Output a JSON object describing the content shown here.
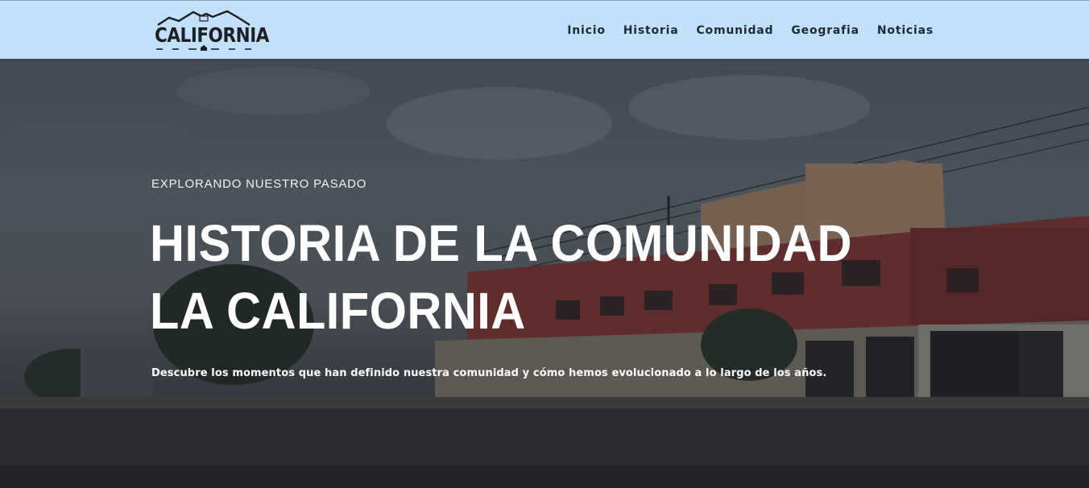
{
  "logo": {
    "text": "CALIFORNIA"
  },
  "nav": [
    {
      "label": "Inicio"
    },
    {
      "label": "Historia"
    },
    {
      "label": "Comunidad"
    },
    {
      "label": "Geografia"
    },
    {
      "label": "Noticias"
    }
  ],
  "hero": {
    "eyebrow": "EXPLORANDO NUESTRO PASADO",
    "title_line1": "HISTORIA DE LA COMUNIDAD",
    "title_line2": "LA CALIFORNIA",
    "subtitle": "Descubre los momentos que han definido nuestra comunidad y cómo hemos evolucionado a lo largo de los años."
  },
  "colors": {
    "topbar": "#c3e0fb",
    "nav_text": "#1e2a36",
    "hero_text": "#ffffff"
  },
  "icons": {
    "logo_mark": "mountain-house-icon"
  }
}
